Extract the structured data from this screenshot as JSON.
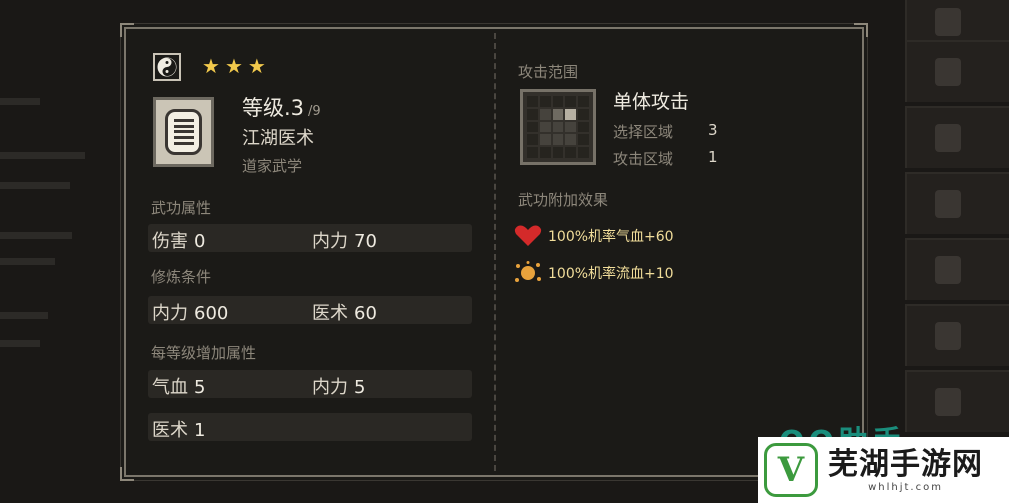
{
  "dialog": {
    "stars": [
      "★",
      "★",
      "★"
    ],
    "level_label": "等级.3",
    "level_max": "/9",
    "skill_name": "江湖医术",
    "skill_school": "道家武学",
    "sections": {
      "attributes": "武功属性",
      "requirements": "修炼条件",
      "per_level": "每等级增加属性"
    },
    "attributes": [
      {
        "label": "伤害",
        "value": "0"
      },
      {
        "label": "内力",
        "value": "70"
      }
    ],
    "requirements": [
      {
        "label": "内力",
        "value": "600"
      },
      {
        "label": "医术",
        "value": "60"
      }
    ],
    "per_level": [
      {
        "label": "气血",
        "value": "5"
      },
      {
        "label": "内力",
        "value": "5"
      },
      {
        "label": "医术",
        "value": "1"
      }
    ],
    "range": {
      "title": "攻击范围",
      "attack_type": "单体攻击",
      "select_label": "选择区域",
      "select_value": "3",
      "attack_label": "攻击区域",
      "attack_value": "1"
    },
    "effects_title": "武功附加效果",
    "effects": [
      {
        "icon": "heart-icon",
        "text": "100%机率气血+60",
        "color": "#d42a2a"
      },
      {
        "icon": "bleed-icon",
        "text": "100%机率流血+10",
        "color": "#e8a23c"
      }
    ]
  },
  "watermark": {
    "title": "芜湖手游网",
    "sub": "whlhjt.com",
    "partial": "QQ助手"
  },
  "colors": {
    "accent_text": "#f1dd9a",
    "star": "#f2c94c",
    "panel_border": "#7b766b"
  }
}
